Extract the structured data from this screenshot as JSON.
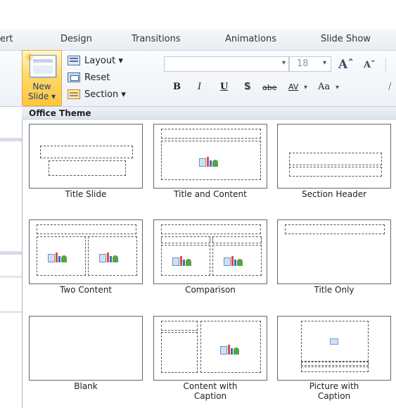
{
  "ribbon_tabs": [
    "ert",
    "Design",
    "Transitions",
    "Animations",
    "Slide Show"
  ],
  "new_slide": {
    "line1": "New",
    "line2": "Slide ▾",
    "sun_icon": "sun-icon"
  },
  "slides_group": {
    "layout": "Layout ▾",
    "reset": "Reset",
    "section": "Section ▾"
  },
  "font": {
    "font_name": "",
    "font_size": "18",
    "dropdown_arrow": "▾",
    "grow_symbol": "Aˆ",
    "shrink_symbol": "Aˇ"
  },
  "format_buttons": {
    "bold": "B",
    "italic": "I",
    "underline": "U",
    "shadow": "S",
    "strike": "abe",
    "spacing": "AV",
    "spacing_arrow": "▾",
    "case": "Aa",
    "case_arrow": "▾",
    "cut": "/"
  },
  "gallery": {
    "header": "Office Theme",
    "layouts": [
      {
        "label_line1": "Title Slide",
        "label_line2": ""
      },
      {
        "label_line1": "Title and Content",
        "label_line2": ""
      },
      {
        "label_line1": "Section Header",
        "label_line2": ""
      },
      {
        "label_line1": "Two Content",
        "label_line2": ""
      },
      {
        "label_line1": "Comparison",
        "label_line2": ""
      },
      {
        "label_line1": "Title Only",
        "label_line2": ""
      },
      {
        "label_line1": "Blank",
        "label_line2": ""
      },
      {
        "label_line1": "Content with",
        "label_line2": "Caption"
      },
      {
        "label_line1": "Picture with",
        "label_line2": "Caption"
      }
    ]
  },
  "colors": {
    "accent_gold": "#ffc53e",
    "ribbon_blue": "#1b3f7a"
  }
}
